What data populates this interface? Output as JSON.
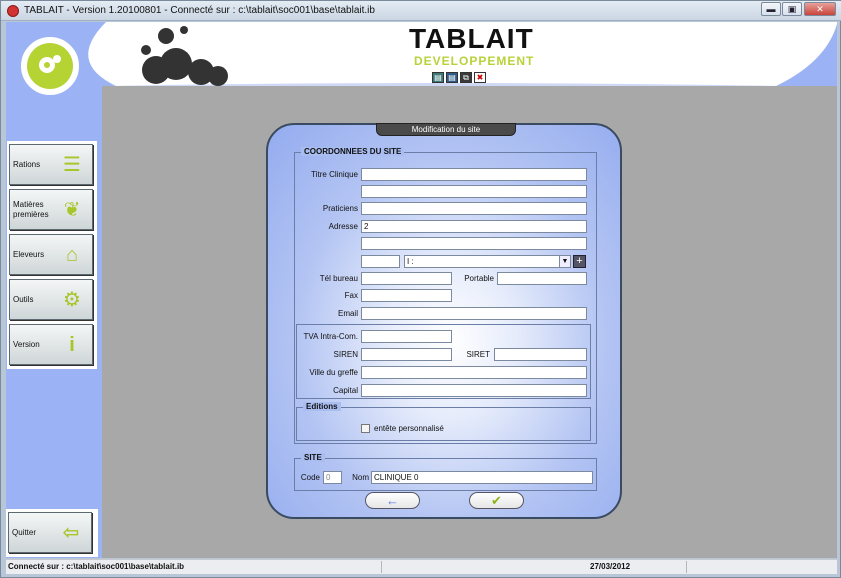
{
  "window": {
    "title": "TABLAIT - Version 1.20100801 - Connecté sur : c:\\tablait\\soc001\\base\\tablait.ib",
    "min": "▬",
    "max": "▣",
    "close": "✕"
  },
  "header": {
    "title": "TABLAIT",
    "subtitle": "DEVELOPPEMENT",
    "toolbar": [
      "▤",
      "▤",
      "⧉",
      "✖"
    ]
  },
  "sidebar": {
    "items": [
      {
        "label": "Rations",
        "icon": "rations-icon"
      },
      {
        "label": "Matières premières",
        "icon": "wheat-icon"
      },
      {
        "label": "Eleveurs",
        "icon": "farm-icon"
      },
      {
        "label": "Outils",
        "icon": "gears-icon"
      },
      {
        "label": "Version",
        "icon": "info-icon"
      }
    ],
    "quit": "Quitter"
  },
  "dialog": {
    "tab": "Modification du site",
    "coord": {
      "legend": "COORDONNEES DU SITE",
      "titre_label": "Titre Clinique",
      "titre_value": "",
      "titre2_value": "",
      "praticiens_label": "Praticiens",
      "praticiens_value": "",
      "adresse_label": "Adresse",
      "adresse_value": "2",
      "adresse2_value": "",
      "cp_value": "",
      "ville_value": "I            :",
      "tel_label": "Tél bureau",
      "tel_value": "",
      "portable_label": "Portable",
      "portable_value": "",
      "fax_label": "Fax",
      "fax_value": "",
      "email_label": "Email",
      "email_value": "",
      "tva_label": "TVA Intra-Com.",
      "tva_value": "",
      "siren_label": "SIREN",
      "siren_value": "",
      "siret_label": "SIRET",
      "siret_value": "",
      "greffe_label": "Ville du greffe",
      "greffe_value": "",
      "capital_label": "Capital",
      "capital_value": "",
      "editions_legend": "Editions",
      "entete_label": "entête personnalisé"
    },
    "site": {
      "legend": "SITE",
      "code_label": "Code",
      "code_value": "0",
      "nom_label": "Nom",
      "nom_value": "CLINIQUE 0"
    },
    "back": "←",
    "ok": "✔"
  },
  "status": {
    "left": "Connecté sur : c:\\tablait\\soc001\\base\\tablait.ib",
    "date": "27/03/2012"
  },
  "colors": {
    "accent": "#b8d23a",
    "panel": "#9bb3f4"
  }
}
